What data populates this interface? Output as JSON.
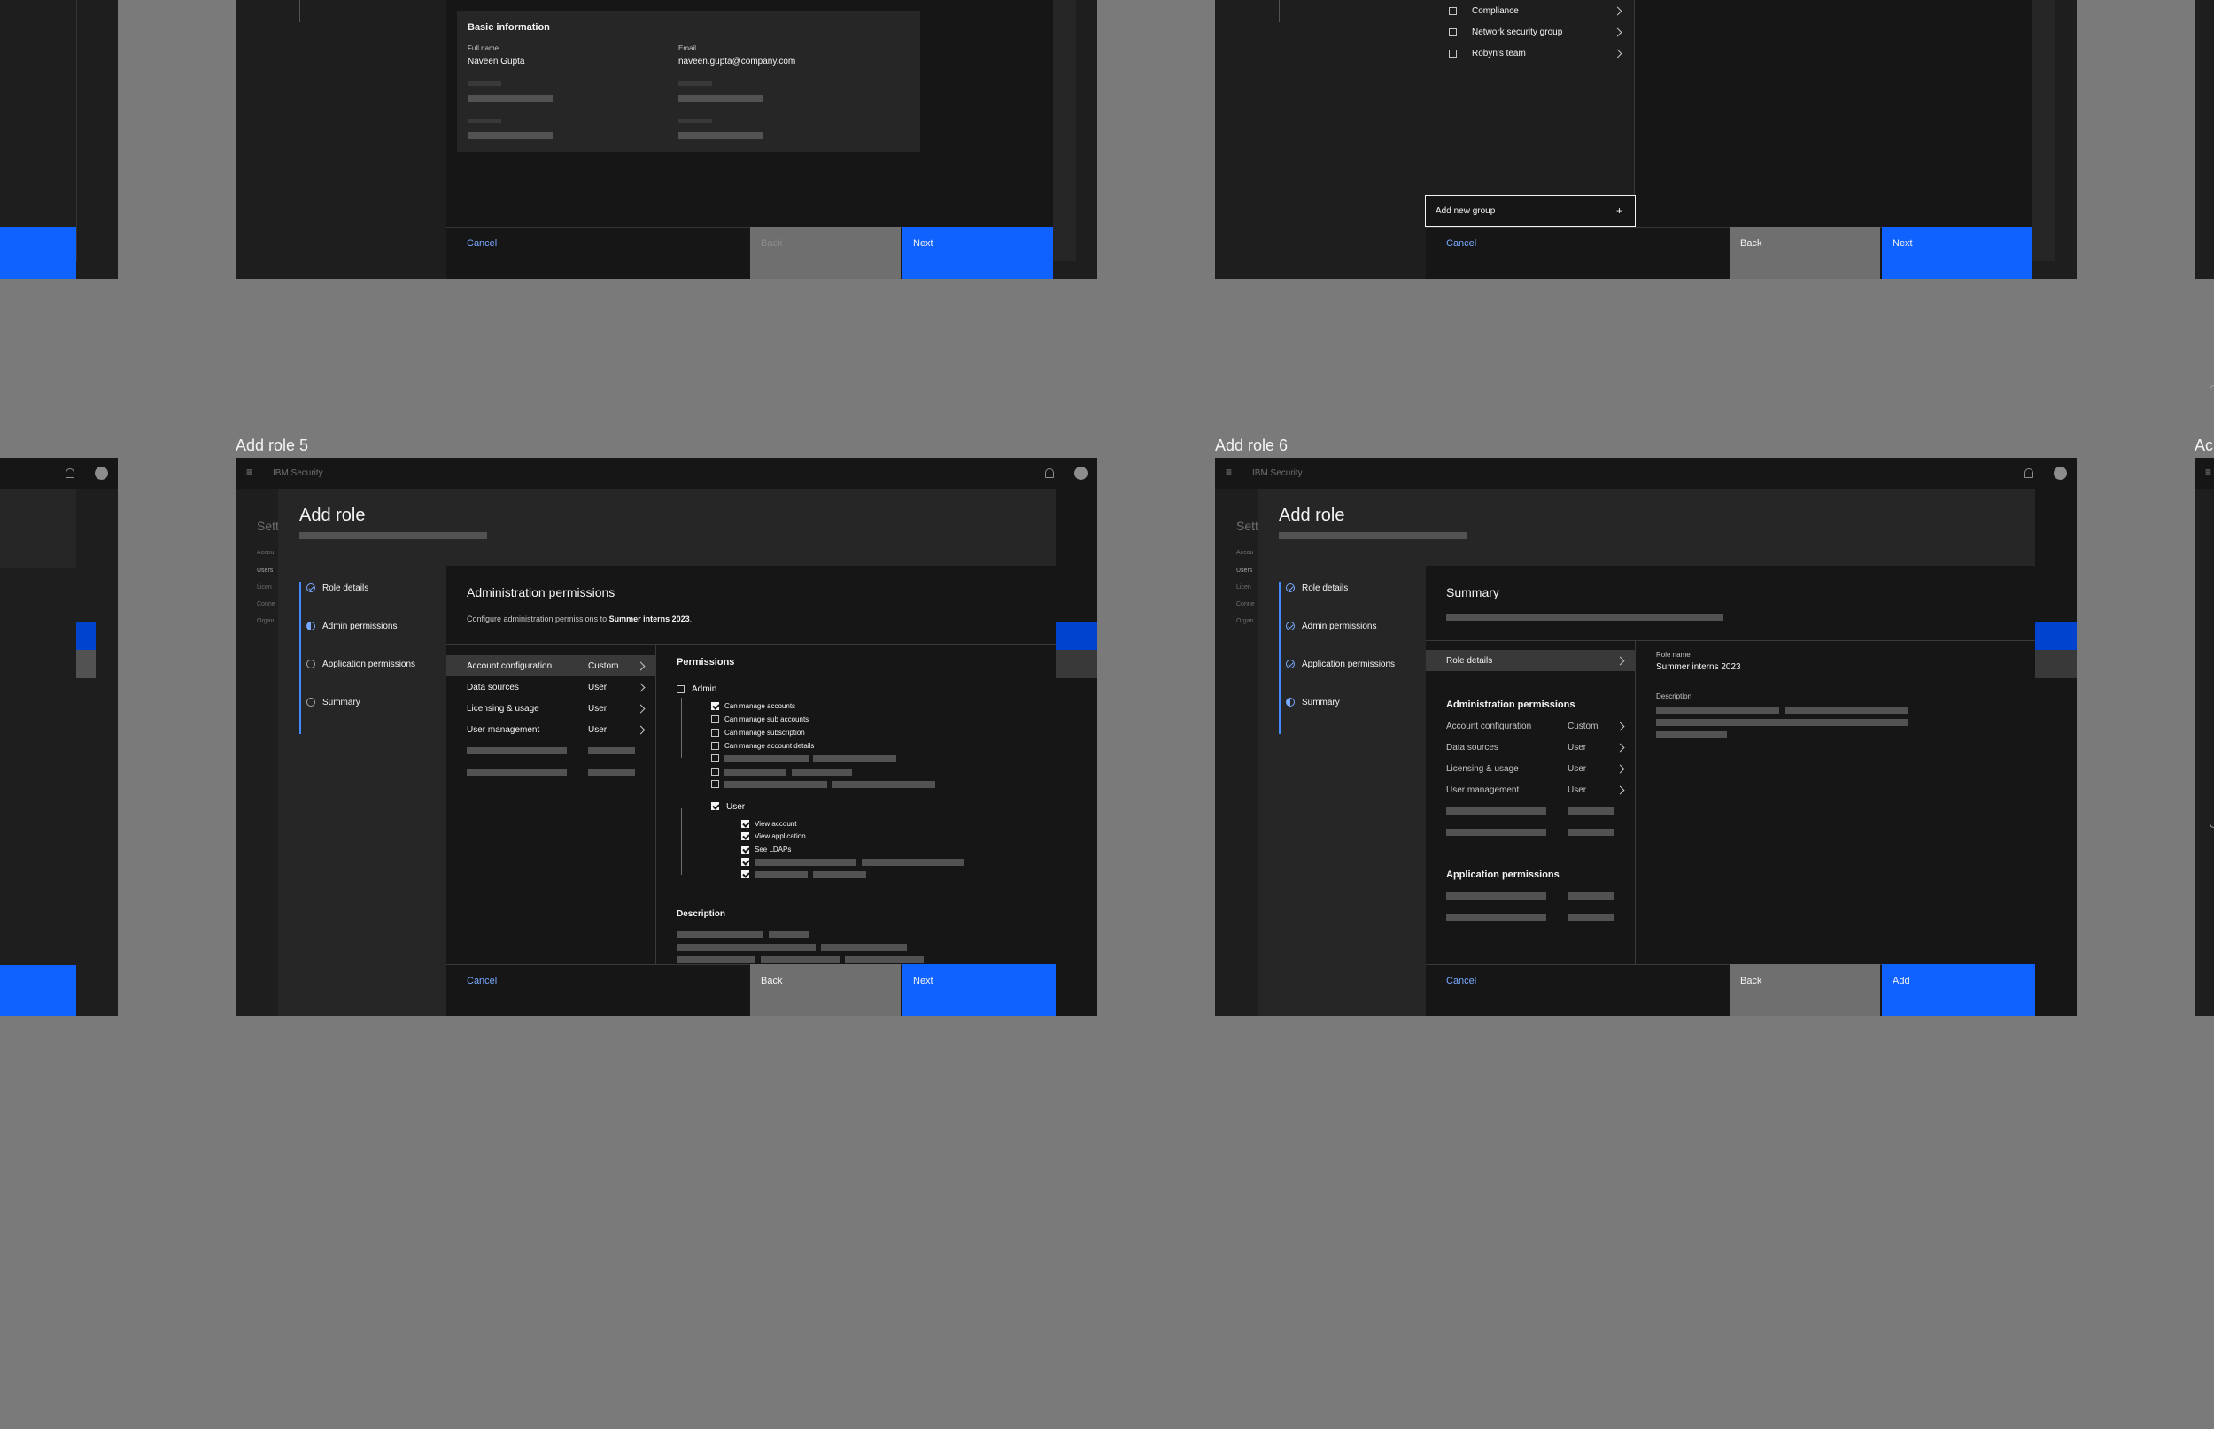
{
  "frame5": {
    "label": "Add role 5"
  },
  "frame6": {
    "label": "Add role 6"
  },
  "frame_partial": {
    "label": "Ac"
  },
  "topbar": {
    "product": "IBM Security"
  },
  "side_partial": {
    "title": "Sett",
    "items": [
      "Accou",
      "Users",
      "Licen",
      "Conne",
      "Organ"
    ]
  },
  "top_left": {
    "section_title": "Basic information",
    "full_name_label": "Full name",
    "full_name_value": "Naveen Gupta",
    "email_label": "Email",
    "email_value": "naveen.gupta@company.com",
    "cancel": "Cancel",
    "back": "Back",
    "next": "Next"
  },
  "top_right": {
    "groups": [
      "Compliance",
      "Network security group",
      "Robyn's team"
    ],
    "add_group": "Add new group",
    "cancel": "Cancel",
    "back": "Back",
    "next": "Next"
  },
  "modal5": {
    "title": "Add role",
    "steps": [
      "Role details",
      "Admin permissions",
      "Application permissions",
      "Summary"
    ],
    "heading": "Administration permissions",
    "desc_prefix": "Configure administration permissions to",
    "desc_role": "Summer interns 2023",
    "desc_suffix": ".",
    "categories": [
      {
        "name": "Account configuration",
        "value": "Custom"
      },
      {
        "name": "Data sources",
        "value": "User"
      },
      {
        "name": "Licensing & usage",
        "value": "User"
      },
      {
        "name": "User management",
        "value": "User"
      }
    ],
    "permissions_title": "Permissions",
    "admin_label": "Admin",
    "admin_items": [
      "Can manage accounts",
      "Can manage sub accounts",
      "Can manage subscription",
      "Can manage account details"
    ],
    "user_label": "User",
    "user_items": [
      "View account",
      "View application",
      "See LDAPs"
    ],
    "description_title": "Description",
    "cancel": "Cancel",
    "back": "Back",
    "next": "Next"
  },
  "modal6": {
    "title": "Add role",
    "steps": [
      "Role details",
      "Admin permissions",
      "Application permissions",
      "Summary"
    ],
    "heading": "Summary",
    "nav_item": "Role details",
    "admin_section": "Administration permissions",
    "categories": [
      {
        "name": "Account configuration",
        "value": "Custom"
      },
      {
        "name": "Data sources",
        "value": "User"
      },
      {
        "name": "Licensing & usage",
        "value": "User"
      },
      {
        "name": "User management",
        "value": "User"
      }
    ],
    "app_section": "Application permissions",
    "role_name_label": "Role name",
    "role_name_value": "Summer interns 2023",
    "description_label": "Description",
    "cancel": "Cancel",
    "back": "Back",
    "add": "Add"
  },
  "colors": {
    "primary": "#0f62fe",
    "bg": "#161616",
    "canvas": "#7a7a7a",
    "layer": "#262626",
    "link": "#78a9ff"
  }
}
